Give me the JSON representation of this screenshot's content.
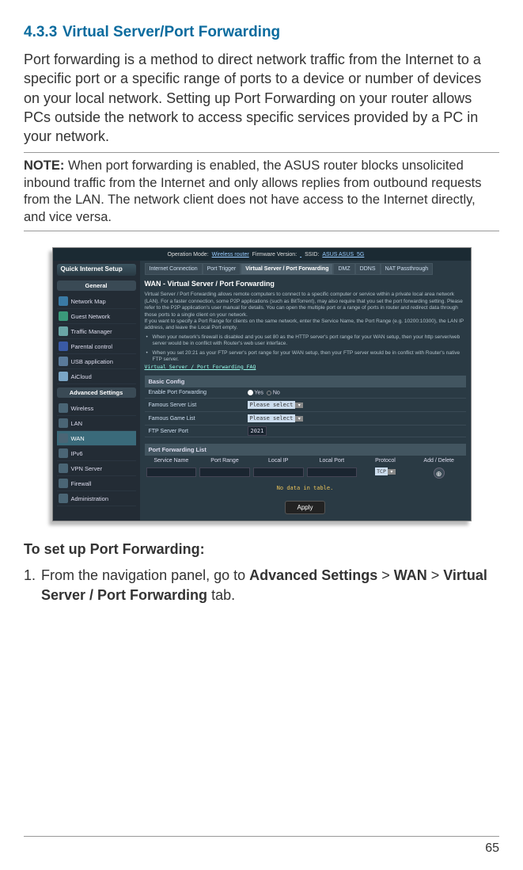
{
  "section": {
    "number": "4.3.3",
    "title": "Virtual Server/Port Forwarding"
  },
  "intro": "Port forwarding is a method to direct network traffic from the Internet to a specific port or a specific range of ports to a device or number of devices on your local network. Setting up Port Forwarding on your router allows PCs outside the network to access specific services provided by a PC in your network.",
  "note": {
    "label": "NOTE:",
    "text": "When port forwarding is enabled, the ASUS router blocks unsolicited inbound traffic from the Internet and only allows replies from outbound requests from the LAN. The network client does not have access to the Internet directly, and vice versa."
  },
  "screenshot": {
    "topbar": {
      "op_label": "Operation Mode:",
      "op_value": "Wireless router",
      "fw_label": "Firmware Version:",
      "ssid_label": "SSID:",
      "ssid_value": "ASUS ASUS_5G"
    },
    "sidebar": {
      "quick": "Quick Internet Setup",
      "general_label": "General",
      "general": [
        "Network Map",
        "Guest Network",
        "Traffic Manager",
        "Parental control",
        "USB application",
        "AiCloud"
      ],
      "advanced_label": "Advanced Settings",
      "advanced": [
        "Wireless",
        "LAN",
        "WAN",
        "IPv6",
        "VPN Server",
        "Firewall",
        "Administration"
      ]
    },
    "tabs": [
      "Internet Connection",
      "Port Trigger",
      "Virtual Server / Port Forwarding",
      "DMZ",
      "DDNS",
      "NAT Passthrough"
    ],
    "main_title": "WAN - Virtual Server / Port Forwarding",
    "desc": "Virtual Server / Port Forwarding allows remote computers to connect to a specific computer or service within a private local area network (LAN). For a faster connection, some P2P applications (such as BitTorrent), may also require that you set the port forwarding setting. Please refer to the P2P application's user manual for details. You can open the multiple port or a range of ports in router and redirect data through those ports to a single client on your network.",
    "desc2": "If you want to specify a Port Range for clients on the same network, enter the Service Name, the Port Range (e.g. 10200:10300), the LAN IP address, and leave the Local Port empty.",
    "bullet1": "When your network's firewall is disabled and you set 80 as the HTTP server's port range for your WAN setup, then your http server/web server would be in conflict with Router's web user interface.",
    "bullet2": "When you set 20:21 as your FTP server's port range for your WAN setup, then your FTP server would be in conflict with Router's native FTP server.",
    "faq": "Virtual Server / Port Forwarding FAQ",
    "config": {
      "header": "Basic Config",
      "rows": [
        {
          "label": "Enable Port Forwarding",
          "type": "radio",
          "yes": "Yes",
          "no": "No"
        },
        {
          "label": "Famous Server List",
          "type": "select",
          "value": "Please select"
        },
        {
          "label": "Famous Game List",
          "type": "select",
          "value": "Please select"
        },
        {
          "label": "FTP Server Port",
          "type": "input",
          "value": "2021"
        }
      ]
    },
    "list": {
      "header": "Port Forwarding List",
      "cols": [
        "Service Name",
        "Port Range",
        "Local IP",
        "Local Port",
        "Protocol",
        "Add / Delete"
      ],
      "protocol": "TCP",
      "nodata": "No data in table.",
      "apply": "Apply"
    }
  },
  "setup": {
    "header": "To set up Port Forwarding:",
    "step1_pre": "From the navigation panel, go to ",
    "step1_a": "Advanced Settings",
    "step1_gt": " > ",
    "step1_b": "WAN",
    "step1_gt2": " > ",
    "step1_c": "Virtual Server / Port Forwarding",
    "step1_post": " tab."
  },
  "page_number": "65"
}
